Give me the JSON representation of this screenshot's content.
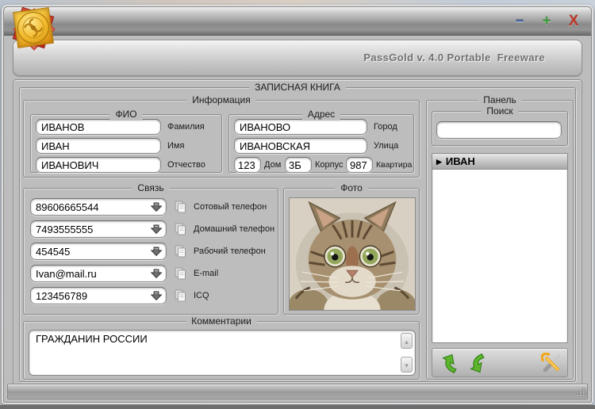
{
  "window": {
    "app_title": "PassGold v. 4.0 Portable  Freeware",
    "controls": {
      "minimize": "−",
      "maximize": "+",
      "close": "X"
    }
  },
  "book": {
    "title": "ЗАПИСНАЯ КНИГА",
    "info": {
      "title": "Информация",
      "fio": {
        "title": "ФИО",
        "fields": [
          {
            "value": "ИВАНОВ",
            "label": "Фамилия"
          },
          {
            "value": "ИВАН",
            "label": "Имя"
          },
          {
            "value": "ИВАНОВИЧ",
            "label": "Отчество"
          }
        ]
      },
      "address": {
        "title": "Адрес",
        "fields": [
          {
            "value": "ИВАНОВО",
            "label": "Город"
          },
          {
            "value": "ИВАНОВСКАЯ",
            "label": "Улица"
          }
        ],
        "house": [
          {
            "value": "123",
            "label": "Дом"
          },
          {
            "value": "3Б",
            "label": "Корпус"
          },
          {
            "value": "987",
            "label": "Квартира"
          }
        ]
      }
    },
    "contacts": {
      "title": "Связь",
      "rows": [
        {
          "value": "89606665544",
          "label": "Сотовый телефон"
        },
        {
          "value": "7493555555",
          "label": "Домашний телефон"
        },
        {
          "value": "454545",
          "label": "Рабочий телефон"
        },
        {
          "value": "Ivan@mail.ru",
          "label": "E-mail"
        },
        {
          "value": "123456789",
          "label": "ICQ"
        }
      ]
    },
    "photo": {
      "title": "Фото"
    },
    "comments": {
      "title": "Комментарии",
      "text": "ГРАЖДАНИН РОССИИ"
    }
  },
  "panel": {
    "title": "Панель",
    "search": {
      "title": "Поиск",
      "value": ""
    },
    "list": {
      "items": [
        {
          "label": "ИВАН",
          "selected": true
        }
      ]
    }
  },
  "icons": {
    "list_marker": "▶",
    "scroll_up": "▴",
    "scroll_down": "▾"
  },
  "colors": {
    "minimize_blue": "#3a5fa8",
    "maximize_green": "#3d9e3d",
    "close_red": "#bf3527",
    "arrow_green": "#5cb52c",
    "wrench_orange": "#f0a818",
    "chrome_gray": "#bdbdbd"
  }
}
